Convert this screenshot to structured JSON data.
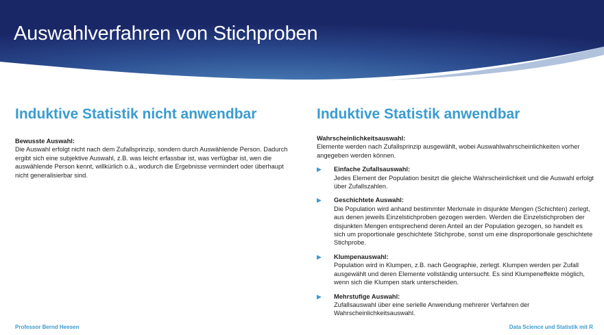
{
  "slide": {
    "title": "Auswahlverfahren von Stichproben",
    "colors": {
      "banner_dark": "#1b2a6b",
      "banner_mid": "#3f73ad",
      "accent": "#3a9bd0"
    }
  },
  "left": {
    "heading": "Induktive Statistik nicht anwendbar",
    "label": "Bewusste Auswahl:",
    "text": "Die Auswahl erfolgt nicht nach dem Zufallsprinzip, sondern durch Auswählende Person. Dadurch ergibt sich eine subjektive Auswahl, z.B. was leicht erfassbar ist, was verfügbar ist, wen die auswählende Person kennt, willkürlich o.ä., wodurch die Ergebnisse vermindert oder überhaupt nicht generalisierbar sind."
  },
  "right": {
    "heading": "Induktive Statistik anwendbar",
    "label": "Wahrscheinlichkeitsauswahl:",
    "text": "Elemente werden nach Zufallsprinzip ausgewählt, wobei Auswahlwahrscheinlichkeiten vorher angegeben werden können.",
    "items": [
      {
        "label": "Einfache Zufallsauswahl:",
        "text": "Jedes Element der Population besitzt die gleiche Wahrscheinlichkeit und die Auswahl erfolgt über Zufallszahlen."
      },
      {
        "label": "Geschichtete Auswahl:",
        "text": "Die Population wird anhand bestimmter Merkmale in disjunkte Mengen (Schichten) zerlegt, aus denen jeweils Einzelstichproben gezogen werden. Werden die Einzelstichproben der disjunkten Mengen entsprechend deren Anteil an der Population gezogen, so handelt es sich um proportionale geschichtete Stichprobe, sonst um eine disproportionale geschichtete Stichprobe."
      },
      {
        "label": "Klumpenauswahl:",
        "text": "Population wird in Klumpen, z.B. nach Geographie, zerlegt. Klumpen werden per Zufall ausgewählt und deren Elemente vollständig untersucht. Es sind Klumpeneffekte möglich, wenn sich die Klumpen stark unterscheiden."
      },
      {
        "label": "Mehrstufige Auswahl:",
        "text": "Zufallsauswahl über eine serielle Anwendung mehrerer Verfahren der Wahrscheinlichkeitsauswahl."
      }
    ]
  },
  "footer": {
    "left": "Professor Bernd Heesen",
    "right": "Data Science und Statistik mit R"
  }
}
